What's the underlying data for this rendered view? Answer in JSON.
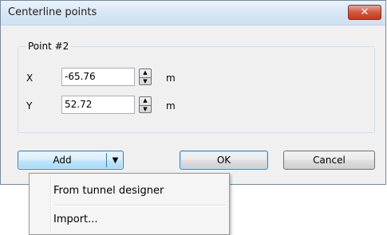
{
  "window": {
    "title": "Centerline points",
    "close_glyph": "✕"
  },
  "group": {
    "legend": "Point #2",
    "fields": [
      {
        "label": "X",
        "value": "-65.76",
        "unit": "m"
      },
      {
        "label": "Y",
        "value": "52.72",
        "unit": "m"
      }
    ],
    "spin_up": "▲",
    "spin_down": "▼"
  },
  "buttons": {
    "add_label": "Add",
    "add_arrow": "▼",
    "ok_label": "OK",
    "cancel_label": "Cancel"
  },
  "menu": {
    "items": [
      "From tunnel designer",
      "Import..."
    ]
  }
}
